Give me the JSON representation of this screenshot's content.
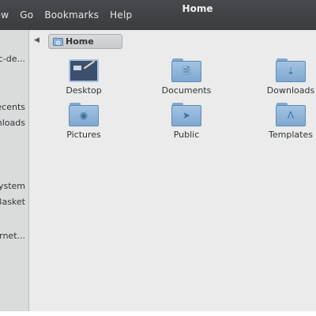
{
  "window": {
    "title": "Home"
  },
  "menu": [
    "View",
    "Go",
    "Bookmarks",
    "Help"
  ],
  "sidebar": {
    "items": [
      {
        "label": "rc-de..."
      },
      {
        "label": "Recents"
      },
      {
        "label": "Downloads"
      },
      {
        "label": "Filesystem"
      },
      {
        "label": "Trash Basket"
      },
      {
        "label": "Internet..."
      }
    ]
  },
  "pathbar": {
    "crumb": "Home"
  },
  "files": [
    {
      "label": "Desktop",
      "icon": "desktop-icon"
    },
    {
      "label": "Documents",
      "icon": "document-icon"
    },
    {
      "label": "Downloads",
      "icon": "download-icon"
    },
    {
      "label": "Pictures",
      "icon": "camera-icon"
    },
    {
      "label": "Public",
      "icon": "share-icon"
    },
    {
      "label": "Templates",
      "icon": "compass-icon"
    }
  ],
  "colors": {
    "titlebar": "#3f4244",
    "sidebar": "#dadcdc",
    "content": "#ebebeb",
    "folder": "#8fb4d9"
  }
}
